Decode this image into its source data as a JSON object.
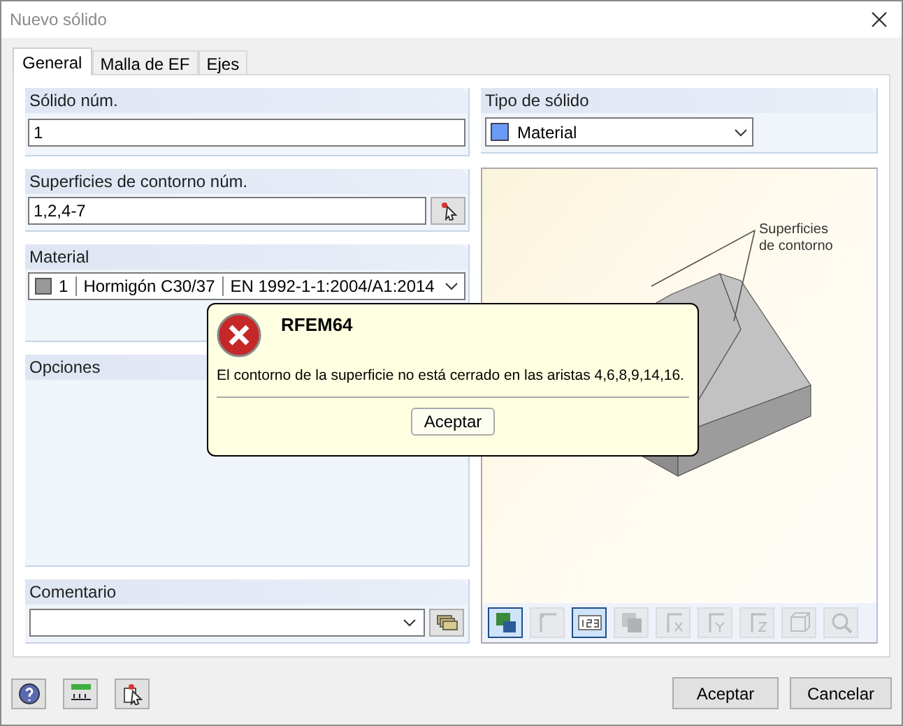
{
  "window": {
    "title": "Nuevo sólido"
  },
  "tabs": [
    {
      "label": "General",
      "selected": true
    },
    {
      "label": "Malla de EF",
      "selected": false
    },
    {
      "label": "Ejes",
      "selected": false
    }
  ],
  "solid_number": {
    "label": "Sólido núm.",
    "value": "1"
  },
  "boundary_surfaces": {
    "label": "Superficies de contorno núm.",
    "value": "1,2,4-7"
  },
  "material": {
    "label": "Material",
    "number": "1",
    "name": "Hormigón C30/37",
    "standard": "EN 1992-1-1:2004/A1:2014"
  },
  "options": {
    "label": "Opciones"
  },
  "comment": {
    "label": "Comentario"
  },
  "solid_type": {
    "label": "Tipo de sólido",
    "value": "Material"
  },
  "preview": {
    "annotation": "Superficies\nde contorno"
  },
  "preview_toolbar": [
    {
      "selected": true,
      "disabled": false
    },
    {
      "selected": false,
      "disabled": true
    },
    {
      "selected": true,
      "disabled": false
    },
    {
      "selected": false,
      "disabled": true
    },
    {
      "selected": false,
      "disabled": true
    },
    {
      "selected": false,
      "disabled": true
    },
    {
      "selected": false,
      "disabled": true
    },
    {
      "selected": false,
      "disabled": true
    },
    {
      "selected": false,
      "disabled": true
    }
  ],
  "buttons": [
    "Aceptar",
    "Cancelar"
  ],
  "message": {
    "title": "RFEM64",
    "text": "El contorno de la superficie no está cerrado en las aristas 4,6,8,9,14,16.",
    "button": "Aceptar"
  }
}
